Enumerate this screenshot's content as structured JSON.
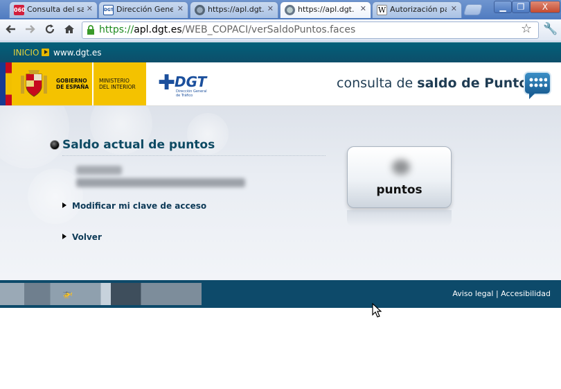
{
  "browser": {
    "tabs": [
      {
        "label": "Consulta del saldo",
        "favicon": "060-icon",
        "active": false
      },
      {
        "label": "Dirección General",
        "favicon": "dgt-icon",
        "active": false
      },
      {
        "label": "https://apl.dgt.es",
        "favicon": "globe-icon",
        "active": false
      },
      {
        "label": "https://apl.dgt.es",
        "favicon": "globe-icon",
        "active": true
      },
      {
        "label": "Autorización para",
        "favicon": "wikipedia-icon",
        "active": false
      }
    ],
    "close_glyph": "✕",
    "window_controls": {
      "minimize": "▁",
      "maximize": "❐",
      "close": "X"
    },
    "url": {
      "scheme": "https://",
      "host": "apl.dgt.es",
      "path": "/WEB_COPACI/verSaldoPuntos.faces"
    },
    "tab_060_text": "060",
    "tab_dgt_text": "DGT",
    "tab_wiki_text": "W"
  },
  "top_strip": {
    "inicio": "INICIO",
    "site": "www.dgt.es"
  },
  "header": {
    "gobierno": [
      "GOBIERNO",
      "DE ESPAÑA"
    ],
    "ministerio": [
      "MINISTERIO",
      "DEL INTERIOR"
    ],
    "dgt_logo": "DGT",
    "dgt_sub": [
      "Dirección General",
      "de Tráfico"
    ],
    "title_light": "consulta de ",
    "title_bold": "saldo de Puntos"
  },
  "main": {
    "section_title": "Saldo actual de puntos",
    "links": {
      "modify_key": "Modificar mi clave de acceso",
      "back": "Volver"
    },
    "points_label": "puntos"
  },
  "footer": {
    "aviso_legal": "Aviso legal",
    "separator": "|",
    "accesibilidad": "Accesibilidad"
  },
  "colors": {
    "brand_dark": "#0d4a6a",
    "accent_yellow": "#f4c200",
    "dgt_blue": "#1b4f9c",
    "link_color": "#0d3a57"
  }
}
